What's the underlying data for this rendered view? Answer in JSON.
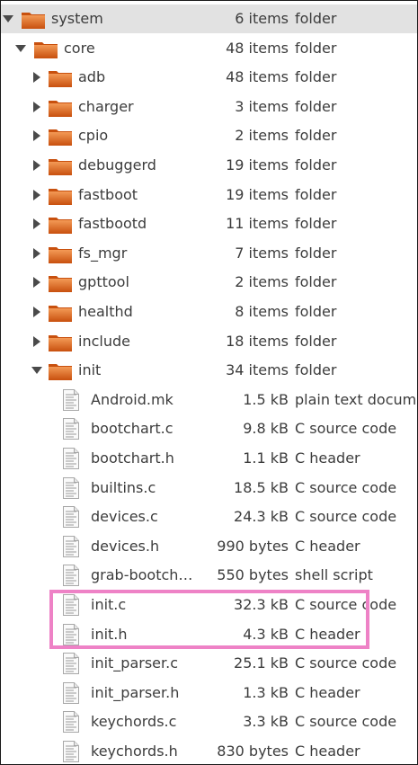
{
  "rows": [
    {
      "name": "system",
      "size": "6 items",
      "type": "folder",
      "kind": "folder",
      "depth": 0,
      "expander": "expanded",
      "icon": "folder-icon"
    },
    {
      "name": "core",
      "size": "48 items",
      "type": "folder",
      "kind": "folder",
      "depth": 1,
      "expander": "expanded",
      "icon": "folder-icon"
    },
    {
      "name": "adb",
      "size": "48 items",
      "type": "folder",
      "kind": "folder",
      "depth": 2,
      "expander": "collapsed",
      "icon": "folder-icon"
    },
    {
      "name": "charger",
      "size": "3 items",
      "type": "folder",
      "kind": "folder",
      "depth": 2,
      "expander": "collapsed",
      "icon": "folder-icon"
    },
    {
      "name": "cpio",
      "size": "2 items",
      "type": "folder",
      "kind": "folder",
      "depth": 2,
      "expander": "collapsed",
      "icon": "folder-icon"
    },
    {
      "name": "debuggerd",
      "size": "19 items",
      "type": "folder",
      "kind": "folder",
      "depth": 2,
      "expander": "collapsed",
      "icon": "folder-icon"
    },
    {
      "name": "fastboot",
      "size": "19 items",
      "type": "folder",
      "kind": "folder",
      "depth": 2,
      "expander": "collapsed",
      "icon": "folder-icon"
    },
    {
      "name": "fastbootd",
      "size": "11 items",
      "type": "folder",
      "kind": "folder",
      "depth": 2,
      "expander": "collapsed",
      "icon": "folder-icon"
    },
    {
      "name": "fs_mgr",
      "size": "7 items",
      "type": "folder",
      "kind": "folder",
      "depth": 2,
      "expander": "collapsed",
      "icon": "folder-icon"
    },
    {
      "name": "gpttool",
      "size": "2 items",
      "type": "folder",
      "kind": "folder",
      "depth": 2,
      "expander": "collapsed",
      "icon": "folder-icon"
    },
    {
      "name": "healthd",
      "size": "8 items",
      "type": "folder",
      "kind": "folder",
      "depth": 2,
      "expander": "collapsed",
      "icon": "folder-icon"
    },
    {
      "name": "include",
      "size": "18 items",
      "type": "folder",
      "kind": "folder",
      "depth": 2,
      "expander": "collapsed",
      "icon": "folder-icon"
    },
    {
      "name": "init",
      "size": "34 items",
      "type": "folder",
      "kind": "folder",
      "depth": 2,
      "expander": "expanded",
      "icon": "folder-icon"
    },
    {
      "name": "Android.mk",
      "size": "1.5 kB",
      "type": "plain text docum",
      "kind": "file",
      "depth": 3,
      "icon": "text-file-icon"
    },
    {
      "name": "bootchart.c",
      "size": "9.8 kB",
      "type": "C source code",
      "kind": "file",
      "depth": 3,
      "icon": "text-file-icon"
    },
    {
      "name": "bootchart.h",
      "size": "1.1 kB",
      "type": "C header",
      "kind": "file",
      "depth": 3,
      "icon": "text-file-icon"
    },
    {
      "name": "builtins.c",
      "size": "18.5 kB",
      "type": "C source code",
      "kind": "file",
      "depth": 3,
      "icon": "text-file-icon"
    },
    {
      "name": "devices.c",
      "size": "24.3 kB",
      "type": "C source code",
      "kind": "file",
      "depth": 3,
      "icon": "text-file-icon"
    },
    {
      "name": "devices.h",
      "size": "990 bytes",
      "type": "C header",
      "kind": "file",
      "depth": 3,
      "icon": "text-file-icon"
    },
    {
      "name": "grab-bootch…",
      "size": "550 bytes",
      "type": "shell script",
      "kind": "file",
      "depth": 3,
      "icon": "text-file-icon"
    },
    {
      "name": "init.c",
      "size": "32.3 kB",
      "type": "C source code",
      "kind": "file",
      "depth": 3,
      "icon": "text-file-icon"
    },
    {
      "name": "init.h",
      "size": "4.3 kB",
      "type": "C header",
      "kind": "file",
      "depth": 3,
      "icon": "text-file-icon"
    },
    {
      "name": "init_parser.c",
      "size": "25.1 kB",
      "type": "C source code",
      "kind": "file",
      "depth": 3,
      "icon": "text-file-icon"
    },
    {
      "name": "init_parser.h",
      "size": "1.3 kB",
      "type": "C header",
      "kind": "file",
      "depth": 3,
      "icon": "text-file-icon"
    },
    {
      "name": "keychords.c",
      "size": "3.3 kB",
      "type": "C source code",
      "kind": "file",
      "depth": 3,
      "icon": "text-file-icon"
    },
    {
      "name": "keychords.h",
      "size": "830 bytes",
      "type": "C header",
      "kind": "file",
      "depth": 3,
      "icon": "text-file-icon"
    }
  ],
  "selected_row": "system",
  "highlighted_rows": [
    "init.c",
    "init.h"
  ],
  "colors": {
    "folder_dark": "#c8500e",
    "folder_light": "#f39a56",
    "highlight_border": "#ee82c6",
    "selected_bg": "#e2e2e2"
  }
}
